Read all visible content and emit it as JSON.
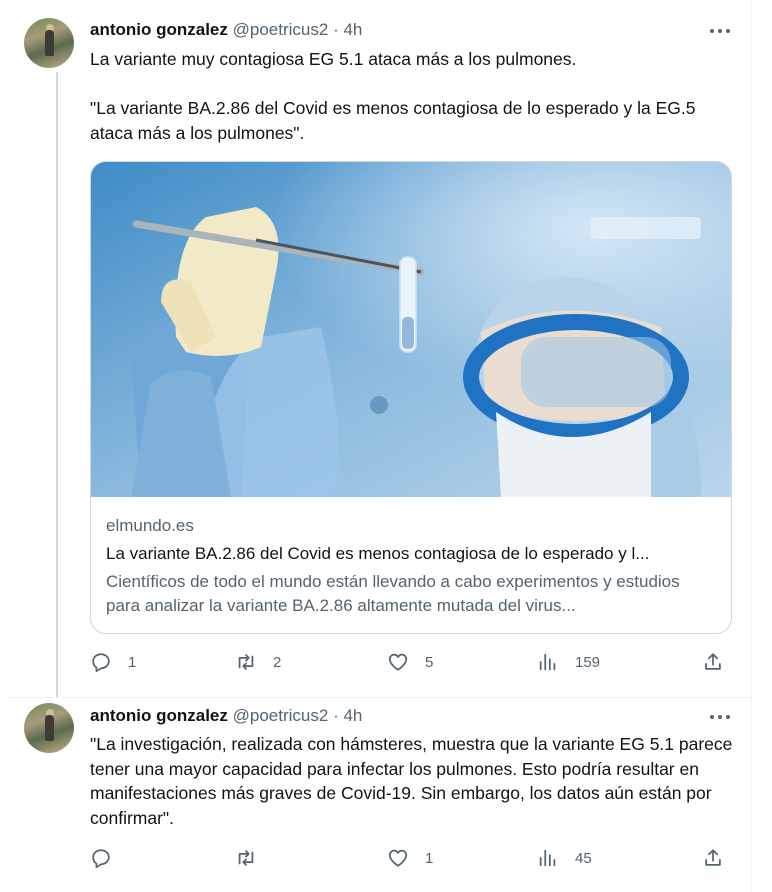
{
  "tweets": [
    {
      "author_name": "antonio gonzalez",
      "handle": "@poetricus2",
      "separator": "·",
      "time": "4h",
      "text": "La variante muy contagiosa EG 5.1 ataca más a los pulmones.\n\n\"La variante BA.2.86 del Covid es menos contagiosa de lo esperado y la EG.5 ataca más a los pulmones\".",
      "card": {
        "image_desc": "scientist-holding-vial",
        "domain": "elmundo.es",
        "title": "La variante BA.2.86 del Covid es menos contagiosa de lo esperado y l...",
        "description": "Científicos de todo el mundo están llevando a cabo experimentos y estudios para analizar la variante BA.2.86 altamente mutada del virus..."
      },
      "stats": {
        "replies": "1",
        "reposts": "2",
        "likes": "5",
        "views": "159"
      }
    },
    {
      "author_name": "antonio gonzalez",
      "handle": "@poetricus2",
      "separator": "·",
      "time": "4h",
      "text": "\"La investigación, realizada con hámsteres, muestra que la variante EG 5.1 parece tener una mayor capacidad para infectar los pulmones. Esto podría resultar en manifestaciones más graves de Covid-19. Sin embargo, los datos aún están por confirmar\".",
      "stats": {
        "replies": "",
        "reposts": "",
        "likes": "1",
        "views": "45"
      }
    }
  ],
  "icons": {
    "reply": "reply-icon",
    "repost": "repost-icon",
    "like": "heart-icon",
    "views": "views-icon",
    "share": "share-icon",
    "more": "more-icon"
  },
  "colors": {
    "text": "#0f1419",
    "secondary": "#536471",
    "border": "#cfd9de"
  }
}
